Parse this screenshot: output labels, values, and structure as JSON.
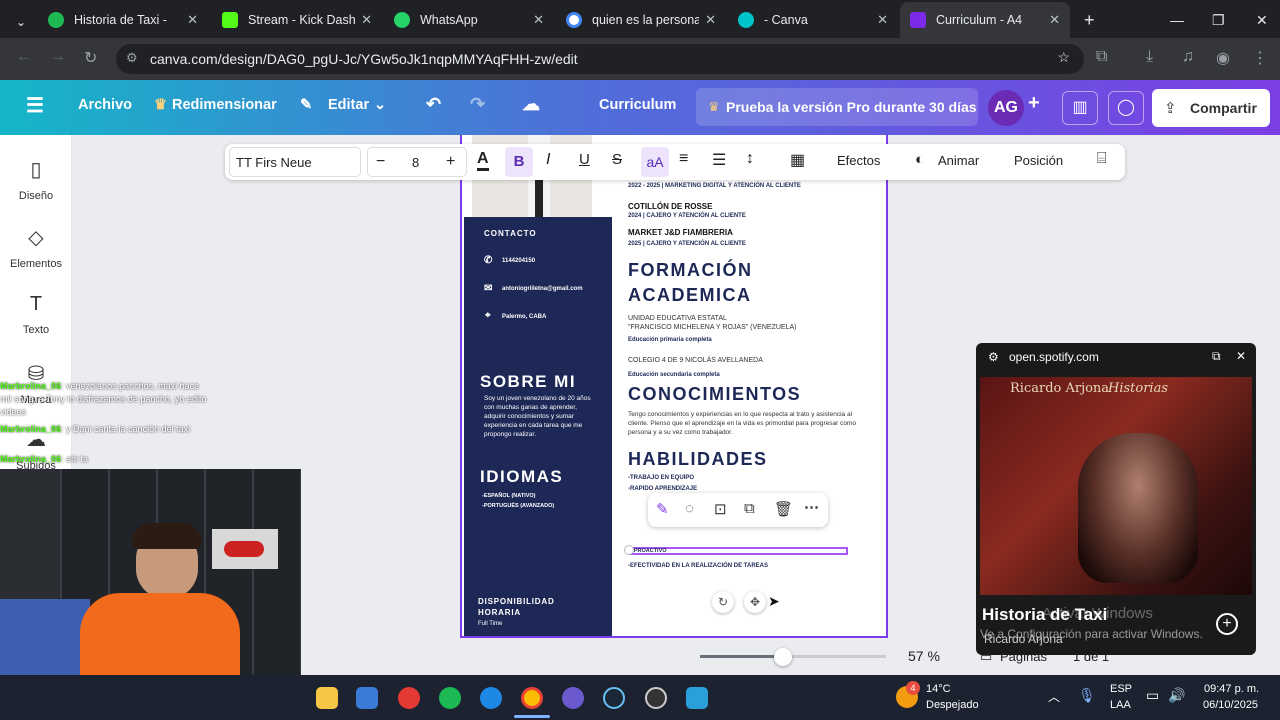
{
  "browser": {
    "tabs": [
      {
        "title": "Historia de Taxi -",
        "color": "#1DB954"
      },
      {
        "title": "Stream - Kick Dashbo",
        "color": "#53FC18"
      },
      {
        "title": "WhatsApp",
        "color": "#25D366"
      },
      {
        "title": "quien es la persona c",
        "color": "#ffffff"
      },
      {
        "title": "- Canva",
        "color": "#00c4cc"
      },
      {
        "title": "Curriculum - A4",
        "color": "#7d2ae8"
      }
    ],
    "url": "canva.com/design/DAG0_pgU-Jc/YGw5oJk1nqpMMYAqFHH-zw/edit"
  },
  "canva_header": {
    "archivo": "Archivo",
    "redimensionar": "Redimensionar",
    "editar": "Editar",
    "doc_title": "Curriculum",
    "pro": "Prueba la versión Pro durante 30 días",
    "avatar": "AG",
    "share": "Compartir"
  },
  "leftrail": {
    "diseno": "Diseño",
    "elementos": "Elementos",
    "texto": "Texto",
    "marca": "Marca",
    "subidos": "Subidos"
  },
  "toolbar": {
    "font": "TT Firs Neue",
    "size": "8",
    "efectos": "Efectos",
    "animar": "Animar",
    "posicion": "Posición"
  },
  "resume": {
    "exp": [
      {
        "name": "",
        "meta": "2022 - 2025 | MARKETING DIGITAL Y ATENCIÓN AL CLIENTE"
      },
      {
        "name": "COTILLÓN DE ROSSE",
        "meta": "2024 | CAJERO Y ATENCIÓN AL CLIENTE"
      },
      {
        "name": "MARKET J&D FIAMBRERIA",
        "meta": "2025 | CAJERO Y ATENCIÓN AL CLIENTE"
      }
    ],
    "contacto": "CONTACTO",
    "phone": "1144204150",
    "email": "antoniogriiletna@gmail.com",
    "location": "Palermo, CABA",
    "sobre_mi_title": "SOBRE MI",
    "sobre_mi_text": "Soy un joven venezolano de 20 años con muchas ganas de aprender, adquirir conocimientos y sumar experiencia en cada tarea que me propongo realizar.",
    "idiomas_title": "IDIOMAS",
    "idiomas": [
      "-ESPAÑOL (NATIVO)",
      "-PORTUGUÉS (AVANZADO)"
    ],
    "disp_title": "DISPONIBILIDAD HORARIA",
    "disp_value": "Full Time",
    "formacion_title": "FORMACIÓN ACADEMICA",
    "edu1_line1": "UNIDAD EDUCATIVA ESTATAL",
    "edu1_line2": "\"FRANCISCO MICHELENA Y ROJAS\" (VENEZUELA)",
    "edu1_sub": "Educación primaria completa",
    "edu2_line1": "COLEGIO 4 DE 9 NICOLÁS AVELLANEDA",
    "edu2_sub": "Educación secundaria completa",
    "conocimientos_title": "CONOCIMIENTOS",
    "conocimientos_text": "Tengo conocimientos y experiencias en lo que respecta al trato y asistencia al cliente. Pienso que el aprendizaje en la vida es primordial para progresar como persona y a su vez como trabajador.",
    "habilidades_title": "HABILIDADES",
    "habilidades": [
      "-TRABAJO EN EQUIPO",
      "-RAPIDO APRENDIZAJE",
      "-PROACTIVO",
      "-EFECTIVIDAD EN LA REALIZACIÓN DE TAREAS"
    ]
  },
  "zoom": "57 %",
  "pages": {
    "label": "Páginas",
    "count": "1 de 1"
  },
  "spotify": {
    "site": "open.spotify.com",
    "album_artist": "Ricardo Arjona",
    "album_title": "Historias",
    "track": "Historia de Taxi",
    "artist": "Ricardo Arjona",
    "win_watermark_1": "Activar Windows",
    "win_watermark_2": "Ve a Configuración para activar Windows."
  },
  "chat": [
    {
      "user": "Marbrolina_06",
      "msg": ": venezolanos panchos, maxi hace mil song, a Tony lo disfrazamos de pancho, yo edito videos"
    },
    {
      "user": "Marbrolina_06",
      "msg": ": y Dani canta la canción del taxi"
    },
    {
      "user": "Marbrolina_06",
      "msg": ": ahi ta"
    }
  ],
  "taskbar": {
    "temp": "14°C",
    "weather": "Despejado",
    "weather_badge": "4",
    "lang1": "ESP",
    "lang2": "LAA",
    "time": "09:47 p. m.",
    "date": "06/10/2025"
  }
}
